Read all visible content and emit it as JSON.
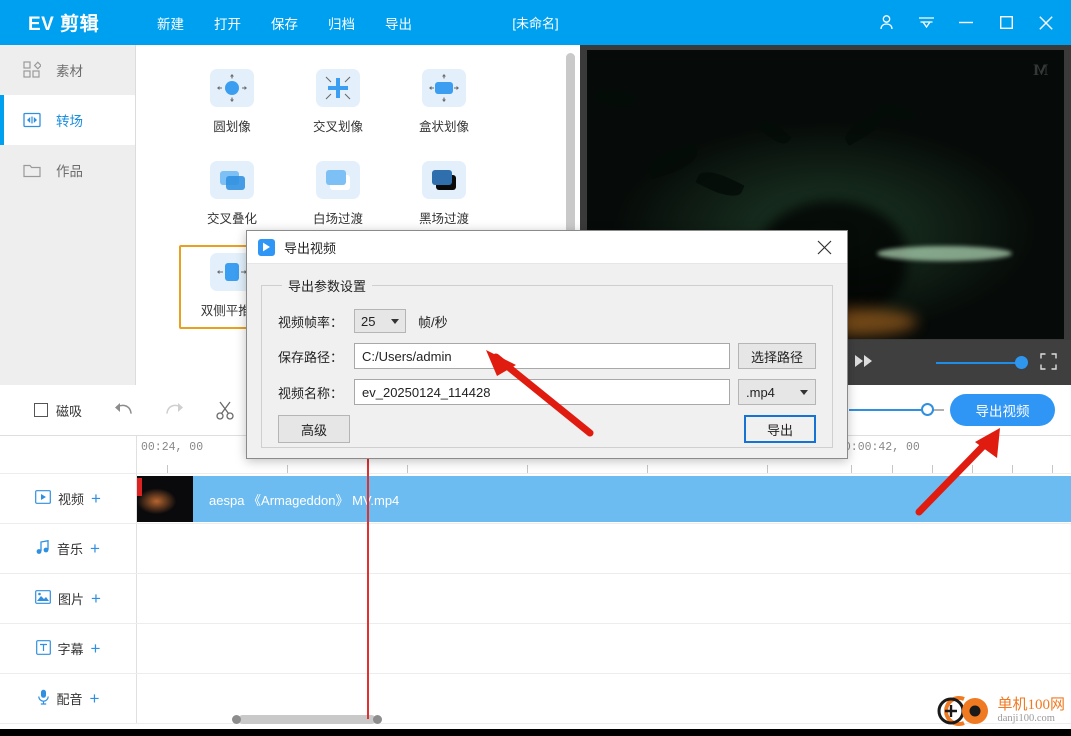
{
  "titlebar": {
    "brand": "EV 剪辑",
    "menu": [
      {
        "label": "新建",
        "name": "menu-new"
      },
      {
        "label": "打开",
        "name": "menu-open"
      },
      {
        "label": "保存",
        "name": "menu-save"
      },
      {
        "label": "归档",
        "name": "menu-archive"
      },
      {
        "label": "导出",
        "name": "menu-export"
      }
    ],
    "doc_title": "[未命名]",
    "accent_color": "#00a0f0",
    "controls": [
      {
        "name": "user-account-icon"
      },
      {
        "name": "main-menu-icon"
      },
      {
        "name": "minimize-icon"
      },
      {
        "name": "maximize-icon"
      },
      {
        "name": "close-icon"
      }
    ]
  },
  "sidebar": {
    "items": [
      {
        "label": "素材",
        "icon": "grid-icon",
        "active": false
      },
      {
        "label": "转场",
        "icon": "transition-icon",
        "active": true
      },
      {
        "label": "作品",
        "icon": "folder-icon",
        "active": false
      }
    ]
  },
  "transitions": {
    "items": [
      {
        "label": "圆划像",
        "selected": false
      },
      {
        "label": "交叉划像",
        "selected": false
      },
      {
        "label": "盒状划像",
        "selected": false
      },
      {
        "label": "交叉叠化",
        "selected": false
      },
      {
        "label": "白场过渡",
        "selected": false
      },
      {
        "label": "黑场过渡",
        "selected": false
      },
      {
        "label": "双侧平推开",
        "selected": true
      },
      {
        "label": "",
        "selected": false
      }
    ],
    "selected_border_color": "#e8a020"
  },
  "preview": {
    "watermark": "M",
    "player": {
      "fast_forward": "fast-forward-icon",
      "volume_level": 92,
      "fullscreen": "fullscreen-icon"
    }
  },
  "toolbar": {
    "magnet_label": "磁吸",
    "magnet_checked": false,
    "undo": "undo-icon",
    "redo": "redo-icon",
    "cut": "scissors-icon",
    "zoom_value": 78,
    "export_label": "导出视频"
  },
  "timeline": {
    "ruler_labels": [
      "00:24, 00",
      "00:00:42, 00"
    ],
    "tracks": [
      {
        "label": "视频",
        "icon": "video-icon",
        "plus": "+"
      },
      {
        "label": "音乐",
        "icon": "music-icon",
        "plus": "+"
      },
      {
        "label": "图片",
        "icon": "image-icon",
        "plus": "+"
      },
      {
        "label": "字幕",
        "icon": "subtitle-icon",
        "plus": "+"
      },
      {
        "label": "配音",
        "icon": "microphone-icon",
        "plus": "+"
      }
    ],
    "clip": {
      "name": "aespa 《Armageddon》 MV.mp4"
    }
  },
  "dialog": {
    "title": "导出视频",
    "close": "×",
    "group_title": "导出参数设置",
    "fields": {
      "fps_label": "视频帧率：",
      "fps_value": "25",
      "fps_unit": "帧/秒",
      "path_label": "保存路径：",
      "path_value": "C:/Users/admin",
      "path_button": "选择路径",
      "name_label": "视频名称：",
      "name_value": "ev_20250124_114428",
      "format_value": ".mp4"
    },
    "advanced_button": "高级",
    "export_button": "导出",
    "export_border_color": "#1573d4"
  },
  "watermark": {
    "cn": "单机100网",
    "en": "danji100.com",
    "color": "#f07a22"
  }
}
